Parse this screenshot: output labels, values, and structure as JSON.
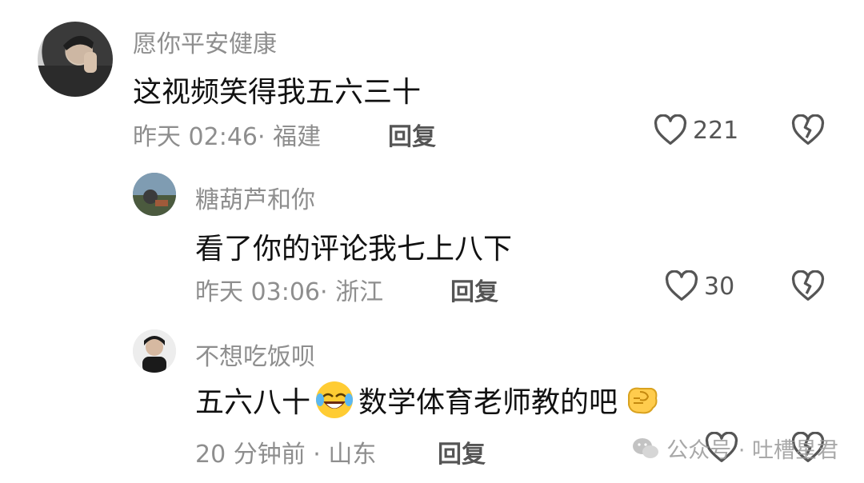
{
  "comments": [
    {
      "username": "愿你平安健康",
      "text": "这视频笑得我五六三十",
      "time_location": "昨天 02:46· 福建",
      "reply_label": "回复",
      "likes": "221"
    },
    {
      "username": "糖葫芦和你",
      "text": "看了你的评论我七上八下",
      "time_location": "昨天 03:06· 浙江",
      "reply_label": "回复",
      "likes": "30"
    },
    {
      "username": "不想吃饭呗",
      "text_part1": "五六八十",
      "text_part2": " 数学体育老师教的吧",
      "time_location": "20 分钟前 · 山东",
      "reply_label": "回复",
      "likes": ""
    }
  ],
  "watermark": {
    "text": "公众号 · 吐槽星君"
  },
  "colors": {
    "text": "#111111",
    "muted": "#8e8e8e",
    "icon": "#555555"
  }
}
